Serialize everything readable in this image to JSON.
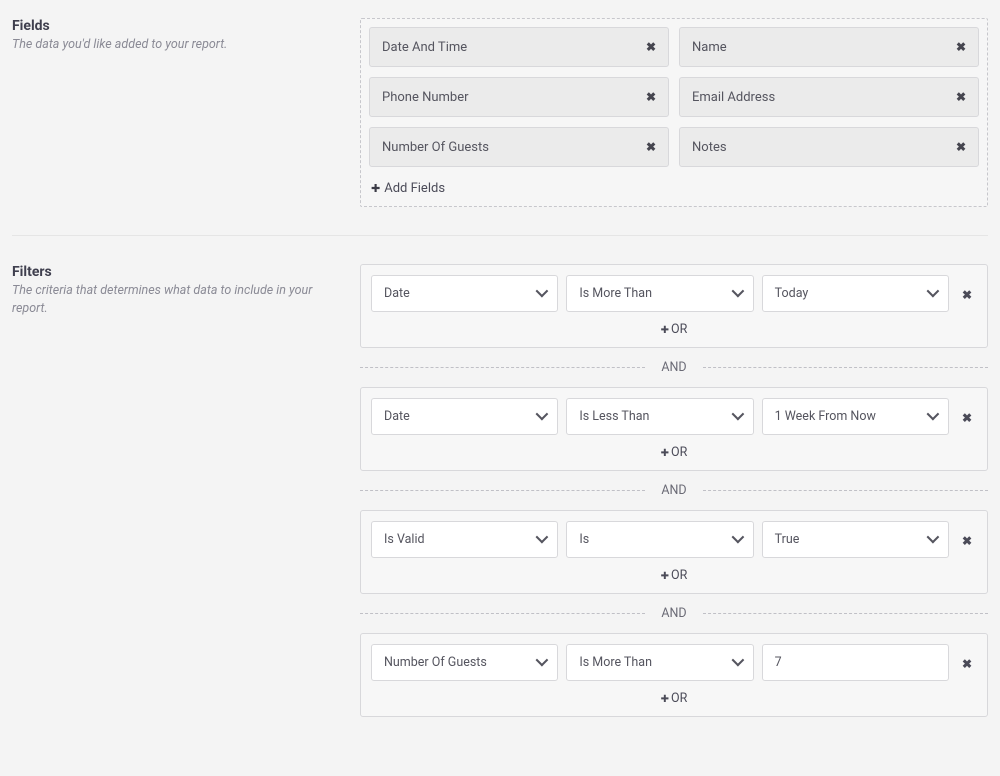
{
  "fields_section": {
    "title": "Fields",
    "subtitle": "The data you'd like added to your report.",
    "items": [
      {
        "label": "Date And Time"
      },
      {
        "label": "Name"
      },
      {
        "label": "Phone Number"
      },
      {
        "label": "Email Address"
      },
      {
        "label": "Number Of Guests"
      },
      {
        "label": "Notes"
      }
    ],
    "add_label": "Add Fields"
  },
  "filters_section": {
    "title": "Filters",
    "subtitle": "The criteria that determines what data to include in your report.",
    "or_label": "OR",
    "and_label": "AND",
    "groups": [
      {
        "field": "Date",
        "operator": "Is More Than",
        "value": "Today",
        "value_type": "select"
      },
      {
        "field": "Date",
        "operator": "Is Less Than",
        "value": "1 Week From Now",
        "value_type": "select"
      },
      {
        "field": "Is Valid",
        "operator": "Is",
        "value": "True",
        "value_type": "select"
      },
      {
        "field": "Number Of Guests",
        "operator": "Is More Than",
        "value": "7",
        "value_type": "input"
      }
    ]
  }
}
